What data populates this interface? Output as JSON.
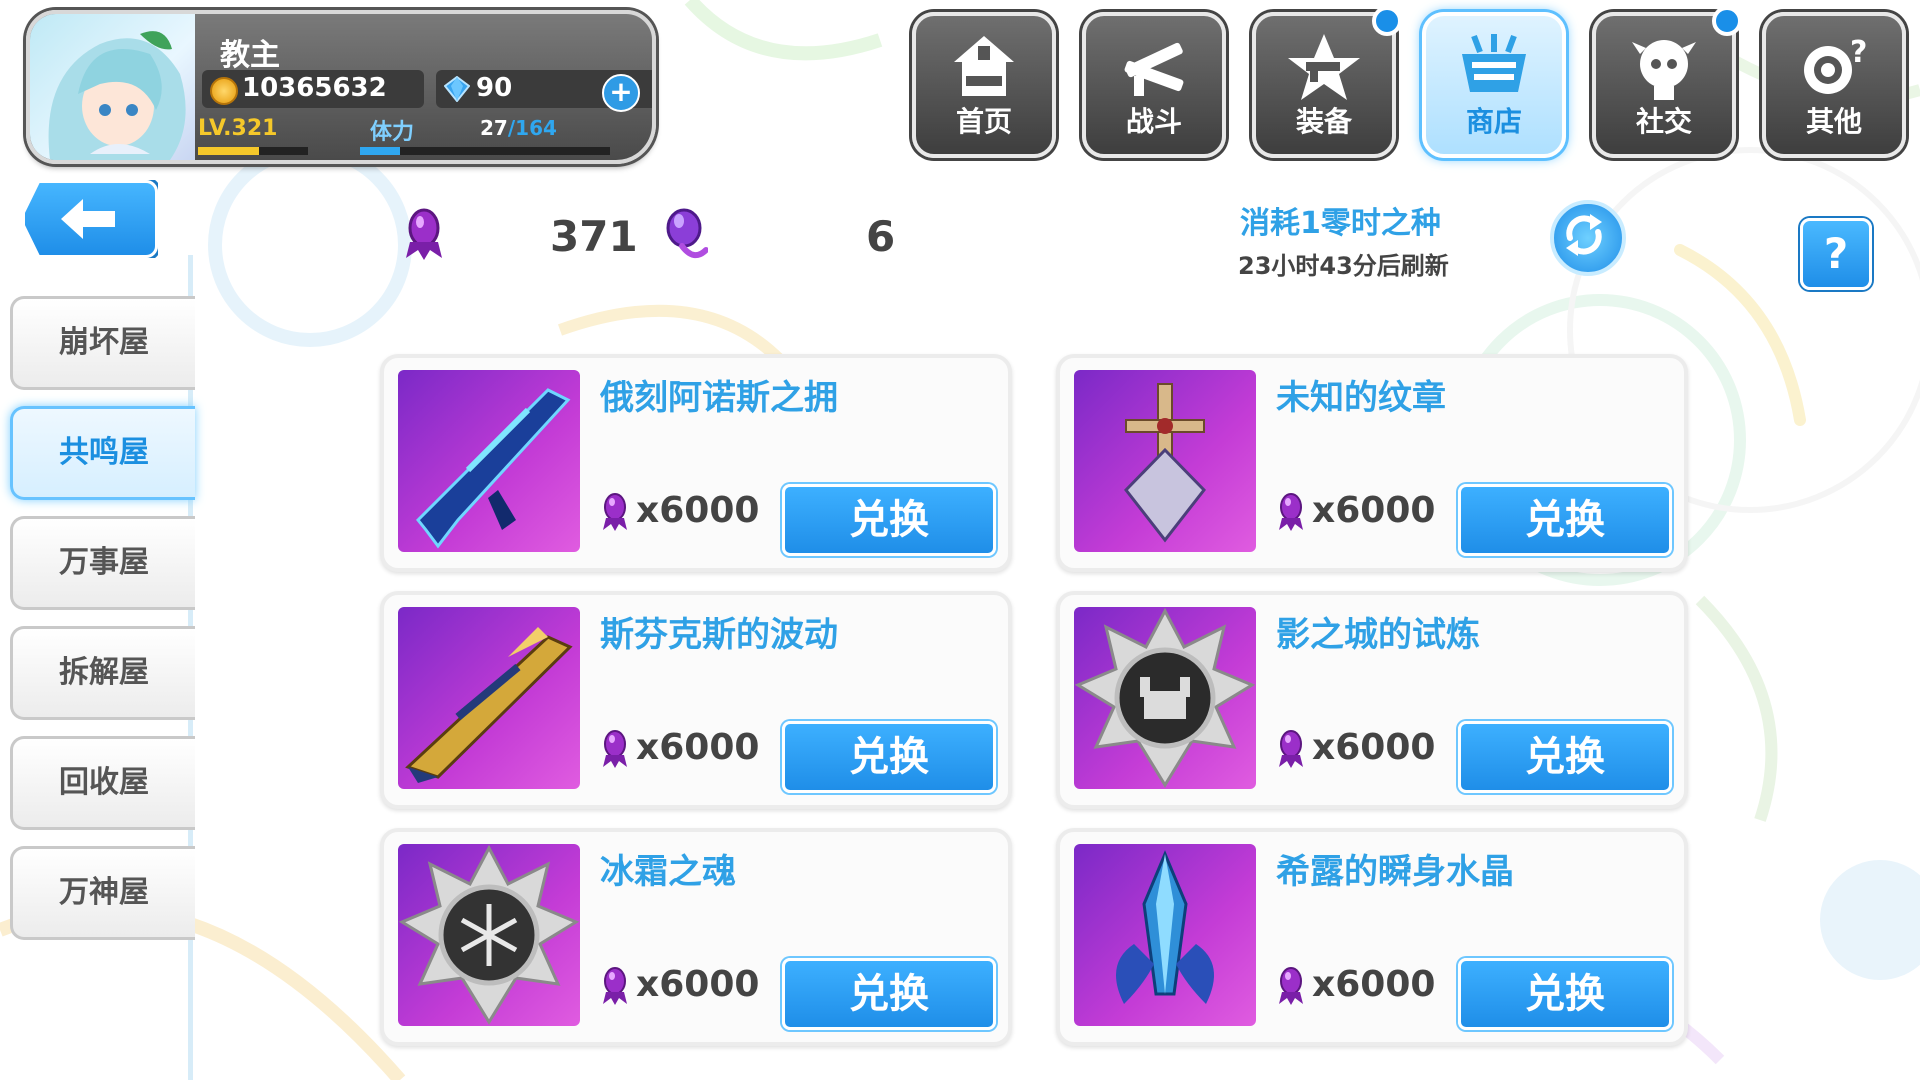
{
  "player": {
    "name": "教主",
    "gold": "10365632",
    "gems": "90",
    "level": "LV.321",
    "level_progress": 0.55,
    "stamina_label": "体力",
    "stamina_current": "27",
    "stamina_max": "/164",
    "stamina_progress": 0.16
  },
  "nav": [
    {
      "label": "首页",
      "icon": "house-icon",
      "badge": false,
      "active": false
    },
    {
      "label": "战斗",
      "icon": "crossed-guns-icon",
      "badge": false,
      "active": false
    },
    {
      "label": "装备",
      "icon": "gun-star-icon",
      "badge": true,
      "active": false
    },
    {
      "label": "商店",
      "icon": "shop-basket-icon",
      "badge": false,
      "active": true
    },
    {
      "label": "社交",
      "icon": "chibi-friend-icon",
      "badge": true,
      "active": false
    },
    {
      "label": "其他",
      "icon": "gear-other-icon",
      "badge": false,
      "active": false
    }
  ],
  "sidebar": {
    "tabs": [
      {
        "label": "崩坏屋",
        "active": false
      },
      {
        "label": "共鸣屋",
        "active": true
      },
      {
        "label": "万事屋",
        "active": false
      },
      {
        "label": "拆解屋",
        "active": false
      },
      {
        "label": "回收屋",
        "active": false
      },
      {
        "label": "万神屋",
        "active": false
      }
    ]
  },
  "currency": {
    "primary_value": "371",
    "primary_icon": "purple-crystal-icon",
    "secondary_value": "6",
    "secondary_icon": "time-seed-icon"
  },
  "refresh": {
    "cost_text": "消耗1零时之种",
    "time_text": "23小时43分后刷新"
  },
  "help_label": "?",
  "items": [
    {
      "name": "俄刻阿诺斯之拥",
      "cost": "x6000",
      "button": "兑换",
      "icon": "blue-rifle-icon"
    },
    {
      "name": "未知的纹章",
      "cost": "x6000",
      "button": "兑换",
      "icon": "cross-emblem-icon"
    },
    {
      "name": "斯芬克斯的波动",
      "cost": "x6000",
      "button": "兑换",
      "icon": "gold-rifle-icon"
    },
    {
      "name": "影之城的试炼",
      "cost": "x6000",
      "button": "兑换",
      "icon": "castle-medal-icon"
    },
    {
      "name": "冰霜之魂",
      "cost": "x6000",
      "button": "兑换",
      "icon": "frost-medal-icon"
    },
    {
      "name": "希露的瞬身水晶",
      "cost": "x6000",
      "button": "兑换",
      "icon": "blue-crystal-icon"
    }
  ],
  "colors": {
    "accent_blue": "#2fa1e6",
    "button_blue": "#1f8ee8",
    "item_bg_purple": "#b236d4",
    "gold_yellow": "#f5c82a"
  }
}
